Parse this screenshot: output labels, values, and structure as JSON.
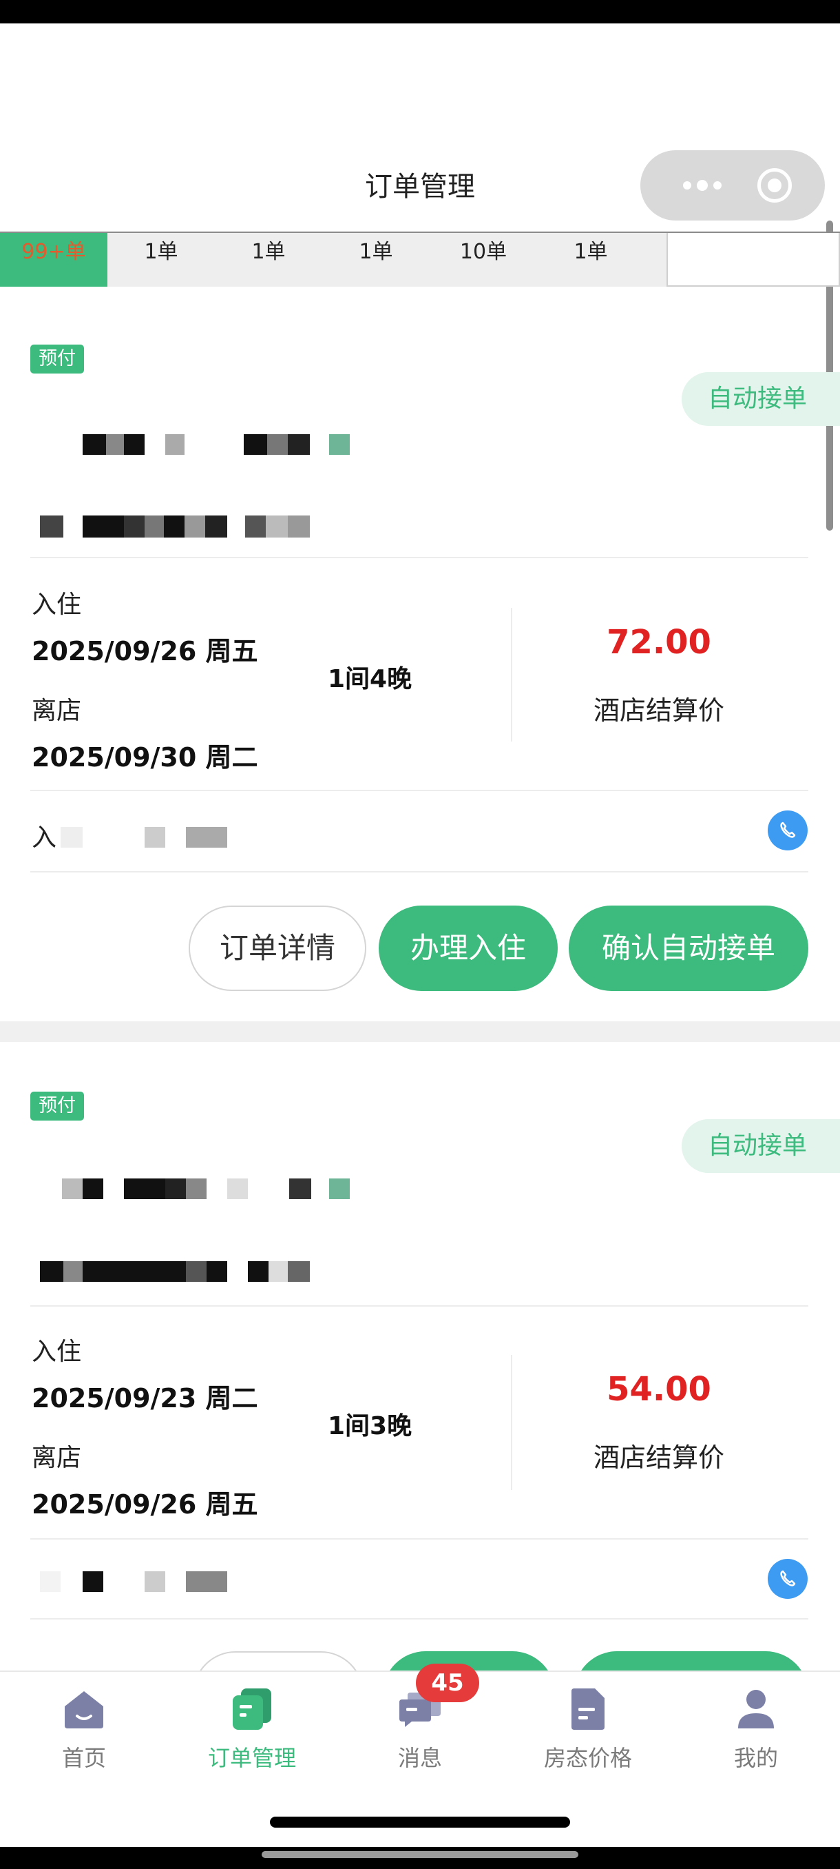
{
  "header": {
    "title": "订单管理"
  },
  "filter_tabs": [
    {
      "count": "99+单"
    },
    {
      "count": "1单"
    },
    {
      "count": "1单"
    },
    {
      "count": "1单"
    },
    {
      "count": "10单"
    },
    {
      "count": "1单"
    },
    {
      "count": ""
    }
  ],
  "orders": [
    {
      "payment_tag": "预付",
      "auto_tag": "自动接单",
      "checkin_label": "入住",
      "checkin_date": "2025/09/26 周五",
      "checkout_label": "离店",
      "checkout_date": "2025/09/30 周二",
      "rooms_nights": "1间4晚",
      "price": "72.00",
      "price_label": "酒店结算价",
      "guest_prefix": "入",
      "buttons": {
        "detail": "订单详情",
        "checkin": "办理入住",
        "confirm": "确认自动接单"
      }
    },
    {
      "payment_tag": "预付",
      "auto_tag": "自动接单",
      "checkin_label": "入住",
      "checkin_date": "2025/09/23 周二",
      "checkout_label": "离店",
      "checkout_date": "2025/09/26 周五",
      "rooms_nights": "1间3晚",
      "price": "54.00",
      "price_label": "酒店结算价"
    }
  ],
  "tabbar": {
    "items": [
      {
        "label": "首页",
        "icon": "home-icon"
      },
      {
        "label": "订单管理",
        "icon": "orders-icon"
      },
      {
        "label": "消息",
        "icon": "message-icon"
      },
      {
        "label": "房态价格",
        "icon": "room-price-icon"
      },
      {
        "label": "我的",
        "icon": "profile-icon"
      }
    ],
    "message_badge": "45"
  },
  "colors": {
    "accent": "#3dba7e",
    "price": "#e02222",
    "badge": "#e53b3b",
    "phone": "#3e9bf2"
  }
}
